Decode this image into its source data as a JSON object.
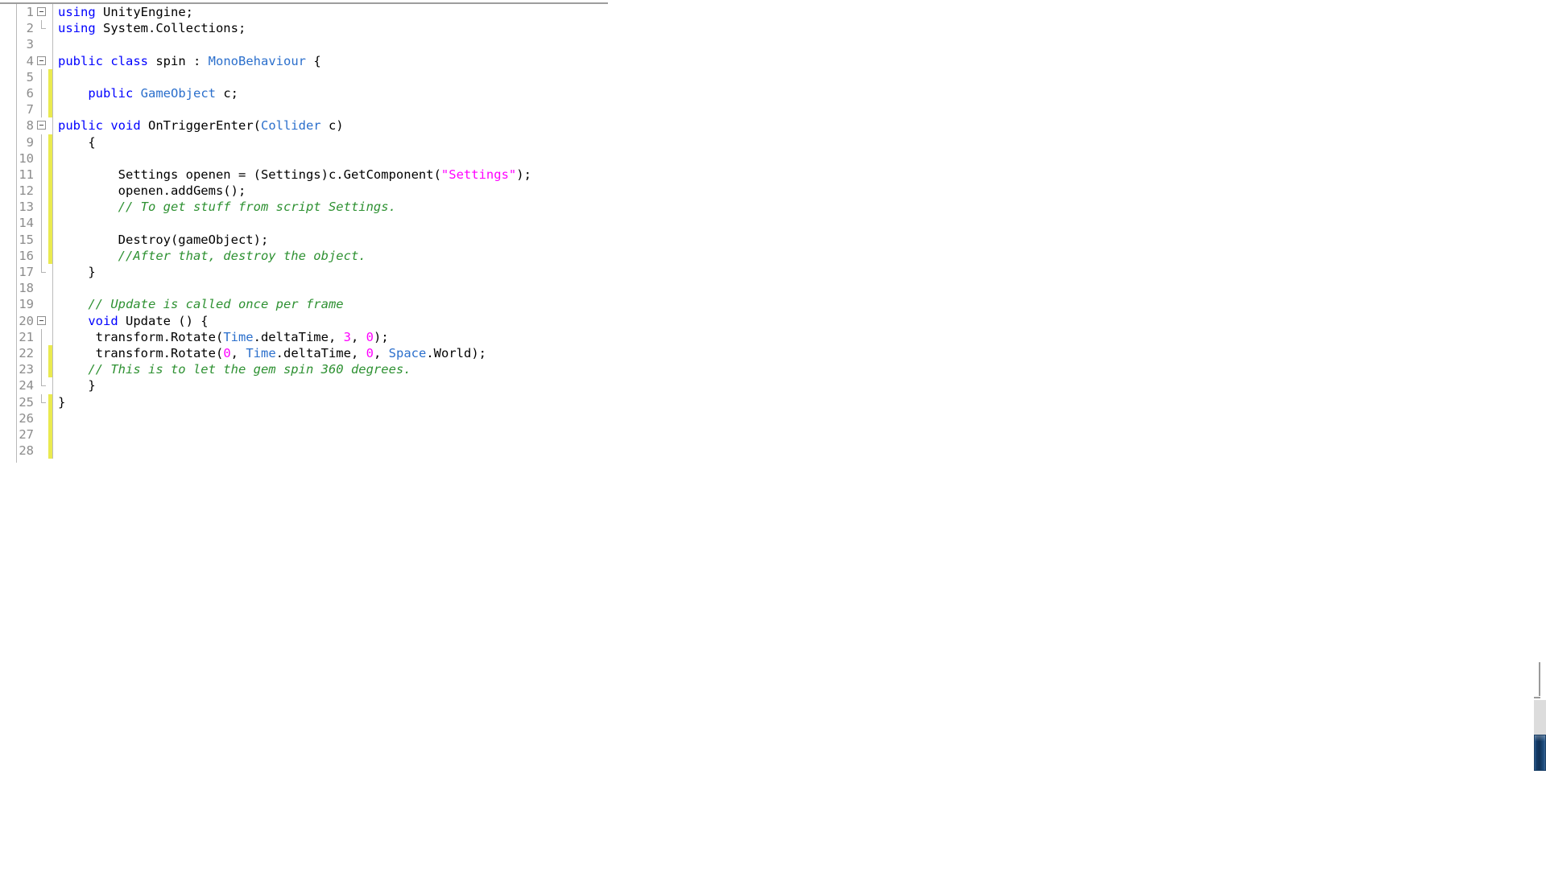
{
  "editor": {
    "language": "csharp",
    "theme_background": "#ffffff",
    "colors": {
      "keyword": "#0000ff",
      "type": "#2b6fcc",
      "string": "#ff00ff",
      "number": "#ff00ff",
      "comment": "#2e9132",
      "plain": "#000000",
      "line_number": "#8c8c8c",
      "change_bar": "#eaea50",
      "gutter_separator": "#bcbcbc",
      "scrollbar_thumb": "#123a68"
    },
    "total_lines": 28,
    "lines": [
      {
        "number": "1",
        "fold": "open",
        "changed": false,
        "tokens": [
          {
            "t": "using",
            "c": "kw"
          },
          {
            "t": " UnityEngine;",
            "c": "pl"
          }
        ]
      },
      {
        "number": "2",
        "fold": "end",
        "changed": false,
        "tokens": [
          {
            "t": "using",
            "c": "kw"
          },
          {
            "t": " System.Collections;",
            "c": "pl"
          }
        ]
      },
      {
        "number": "3",
        "fold": "none",
        "changed": false,
        "tokens": []
      },
      {
        "number": "4",
        "fold": "open",
        "changed": false,
        "tokens": [
          {
            "t": "public",
            "c": "kw"
          },
          {
            "t": " ",
            "c": "pl"
          },
          {
            "t": "class",
            "c": "kw"
          },
          {
            "t": " spin : ",
            "c": "pl"
          },
          {
            "t": "MonoBehaviour",
            "c": "typ"
          },
          {
            "t": " {",
            "c": "pl"
          }
        ]
      },
      {
        "number": "5",
        "fold": "bar",
        "changed": true,
        "tokens": []
      },
      {
        "number": "6",
        "fold": "bar",
        "changed": true,
        "tokens": [
          {
            "t": "    ",
            "c": "pl"
          },
          {
            "t": "public",
            "c": "kw"
          },
          {
            "t": " ",
            "c": "pl"
          },
          {
            "t": "GameObject",
            "c": "typ"
          },
          {
            "t": " c;",
            "c": "pl"
          }
        ]
      },
      {
        "number": "7",
        "fold": "bar",
        "changed": true,
        "tokens": []
      },
      {
        "number": "8",
        "fold": "open",
        "changed": false,
        "tokens": [
          {
            "t": "public",
            "c": "kw"
          },
          {
            "t": " ",
            "c": "pl"
          },
          {
            "t": "void",
            "c": "kw"
          },
          {
            "t": " OnTriggerEnter(",
            "c": "pl"
          },
          {
            "t": "Collider",
            "c": "typ"
          },
          {
            "t": " c)",
            "c": "pl"
          }
        ]
      },
      {
        "number": "9",
        "fold": "bar",
        "changed": true,
        "tokens": [
          {
            "t": "    {",
            "c": "pl"
          }
        ]
      },
      {
        "number": "10",
        "fold": "bar",
        "changed": true,
        "tokens": []
      },
      {
        "number": "11",
        "fold": "bar",
        "changed": true,
        "tokens": [
          {
            "t": "        Settings openen = (Settings)c.GetComponent(",
            "c": "pl"
          },
          {
            "t": "\"Settings\"",
            "c": "str"
          },
          {
            "t": ");",
            "c": "pl"
          }
        ]
      },
      {
        "number": "12",
        "fold": "bar",
        "changed": true,
        "tokens": [
          {
            "t": "        openen.addGems();",
            "c": "pl"
          }
        ]
      },
      {
        "number": "13",
        "fold": "bar",
        "changed": true,
        "tokens": [
          {
            "t": "        ",
            "c": "pl"
          },
          {
            "t": "// To get stuff from script Settings.",
            "c": "com"
          }
        ]
      },
      {
        "number": "14",
        "fold": "bar",
        "changed": true,
        "tokens": []
      },
      {
        "number": "15",
        "fold": "bar",
        "changed": true,
        "tokens": [
          {
            "t": "        Destroy(gameObject);",
            "c": "pl"
          }
        ]
      },
      {
        "number": "16",
        "fold": "bar",
        "changed": true,
        "tokens": [
          {
            "t": "        ",
            "c": "pl"
          },
          {
            "t": "//After that, destroy the object.",
            "c": "com"
          }
        ]
      },
      {
        "number": "17",
        "fold": "end",
        "changed": false,
        "tokens": [
          {
            "t": "    }",
            "c": "pl"
          }
        ]
      },
      {
        "number": "18",
        "fold": "none",
        "changed": false,
        "tokens": []
      },
      {
        "number": "19",
        "fold": "none",
        "changed": false,
        "tokens": [
          {
            "t": "    ",
            "c": "pl"
          },
          {
            "t": "// Update is called once per frame",
            "c": "com"
          }
        ]
      },
      {
        "number": "20",
        "fold": "open",
        "changed": false,
        "tokens": [
          {
            "t": "    ",
            "c": "pl"
          },
          {
            "t": "void",
            "c": "kw"
          },
          {
            "t": " Update () {",
            "c": "pl"
          }
        ]
      },
      {
        "number": "21",
        "fold": "bar",
        "changed": false,
        "tokens": [
          {
            "t": "     transform.Rotate(",
            "c": "pl"
          },
          {
            "t": "Time",
            "c": "typ"
          },
          {
            "t": ".deltaTime, ",
            "c": "pl"
          },
          {
            "t": "3",
            "c": "num"
          },
          {
            "t": ", ",
            "c": "pl"
          },
          {
            "t": "0",
            "c": "num"
          },
          {
            "t": ");",
            "c": "pl"
          }
        ]
      },
      {
        "number": "22",
        "fold": "bar",
        "changed": true,
        "tokens": [
          {
            "t": "     transform.Rotate(",
            "c": "pl"
          },
          {
            "t": "0",
            "c": "num"
          },
          {
            "t": ", ",
            "c": "pl"
          },
          {
            "t": "Time",
            "c": "typ"
          },
          {
            "t": ".deltaTime, ",
            "c": "pl"
          },
          {
            "t": "0",
            "c": "num"
          },
          {
            "t": ", ",
            "c": "pl"
          },
          {
            "t": "Space",
            "c": "typ"
          },
          {
            "t": ".World);",
            "c": "pl"
          }
        ]
      },
      {
        "number": "23",
        "fold": "bar",
        "changed": true,
        "tokens": [
          {
            "t": "    ",
            "c": "pl"
          },
          {
            "t": "// This is to let the gem spin 360 degrees.",
            "c": "com"
          }
        ]
      },
      {
        "number": "24",
        "fold": "end",
        "changed": false,
        "tokens": [
          {
            "t": "    }",
            "c": "pl"
          }
        ]
      },
      {
        "number": "25",
        "fold": "end",
        "changed": true,
        "tokens": [
          {
            "t": "}",
            "c": "pl"
          }
        ]
      },
      {
        "number": "26",
        "fold": "none",
        "changed": true,
        "tokens": []
      },
      {
        "number": "27",
        "fold": "none",
        "changed": true,
        "tokens": []
      },
      {
        "number": "28",
        "fold": "none",
        "changed": true,
        "tokens": []
      }
    ]
  },
  "scrollbar": {
    "orientation": "vertical",
    "position": "right"
  }
}
